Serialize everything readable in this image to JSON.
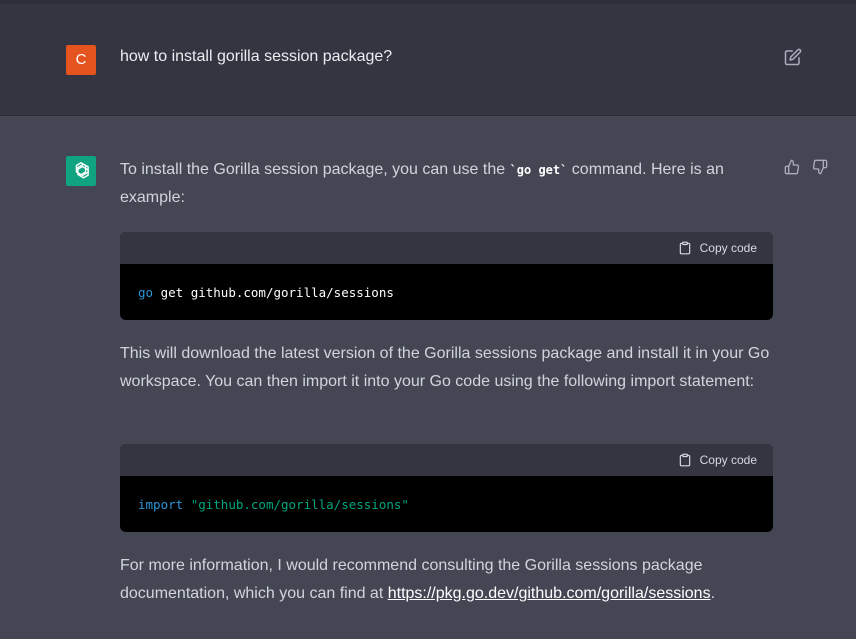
{
  "user_message": {
    "avatar_letter": "C",
    "text": "how to install gorilla session package?",
    "edit_icon": "edit-icon"
  },
  "assistant_message": {
    "intro_before": "To install the Gorilla session package, you can use the ",
    "intro_code": "`go get`",
    "intro_after": " command. Here is an example:",
    "code_block_1": {
      "copy_label": "Copy code",
      "keyword": "go",
      "rest": " get github.com/gorilla/sessions"
    },
    "middle_text": "This will download the latest version of the Gorilla sessions package and install it in your Go workspace. You can then import it into your Go code using the following import statement:",
    "code_block_2": {
      "copy_label": "Copy code",
      "keyword": "import",
      "space": " ",
      "string": "\"github.com/gorilla/sessions\""
    },
    "outro_before": "For more information, I would recommend consulting the Gorilla sessions package documentation, which you can find at ",
    "outro_link": "https://pkg.go.dev/github.com/gorilla/sessions",
    "outro_after": "."
  },
  "colors": {
    "user_row_bg": "#343541",
    "assistant_row_bg": "#444654",
    "user_avatar": "#e5531f",
    "assistant_avatar": "#10a37f",
    "code_keyword": "#2e95d3",
    "code_string": "#00a67d"
  }
}
